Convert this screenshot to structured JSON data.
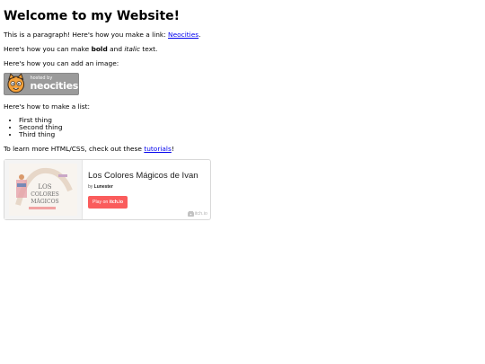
{
  "heading": "Welcome to my Website!",
  "p1": {
    "text": "This is a paragraph! Here's how you make a link: ",
    "link": "Neocities",
    "end": "."
  },
  "p2": {
    "start": "Here's how you can make ",
    "bold": "bold",
    "mid": " and ",
    "italic": "italic",
    "end": " text."
  },
  "p3": "Here's how you can add an image:",
  "badge": {
    "small_text": "hosted by",
    "big_text": "neocities",
    "icon": "neocities-cat-icon"
  },
  "p4": "Here's how to make a list:",
  "list": [
    "First thing",
    "Second thing",
    "Third thing"
  ],
  "p5": {
    "start": "To learn more HTML/CSS, check out these ",
    "link": "tutorials",
    "end": "!"
  },
  "embed": {
    "title": "Los Colores Mágicos de Ivan",
    "by_prefix": "by ",
    "author": "Lunester",
    "play_prefix": "Play on ",
    "play_site": "itch.io",
    "logo_text": "itch.io",
    "accent": "#fa5c5c"
  }
}
